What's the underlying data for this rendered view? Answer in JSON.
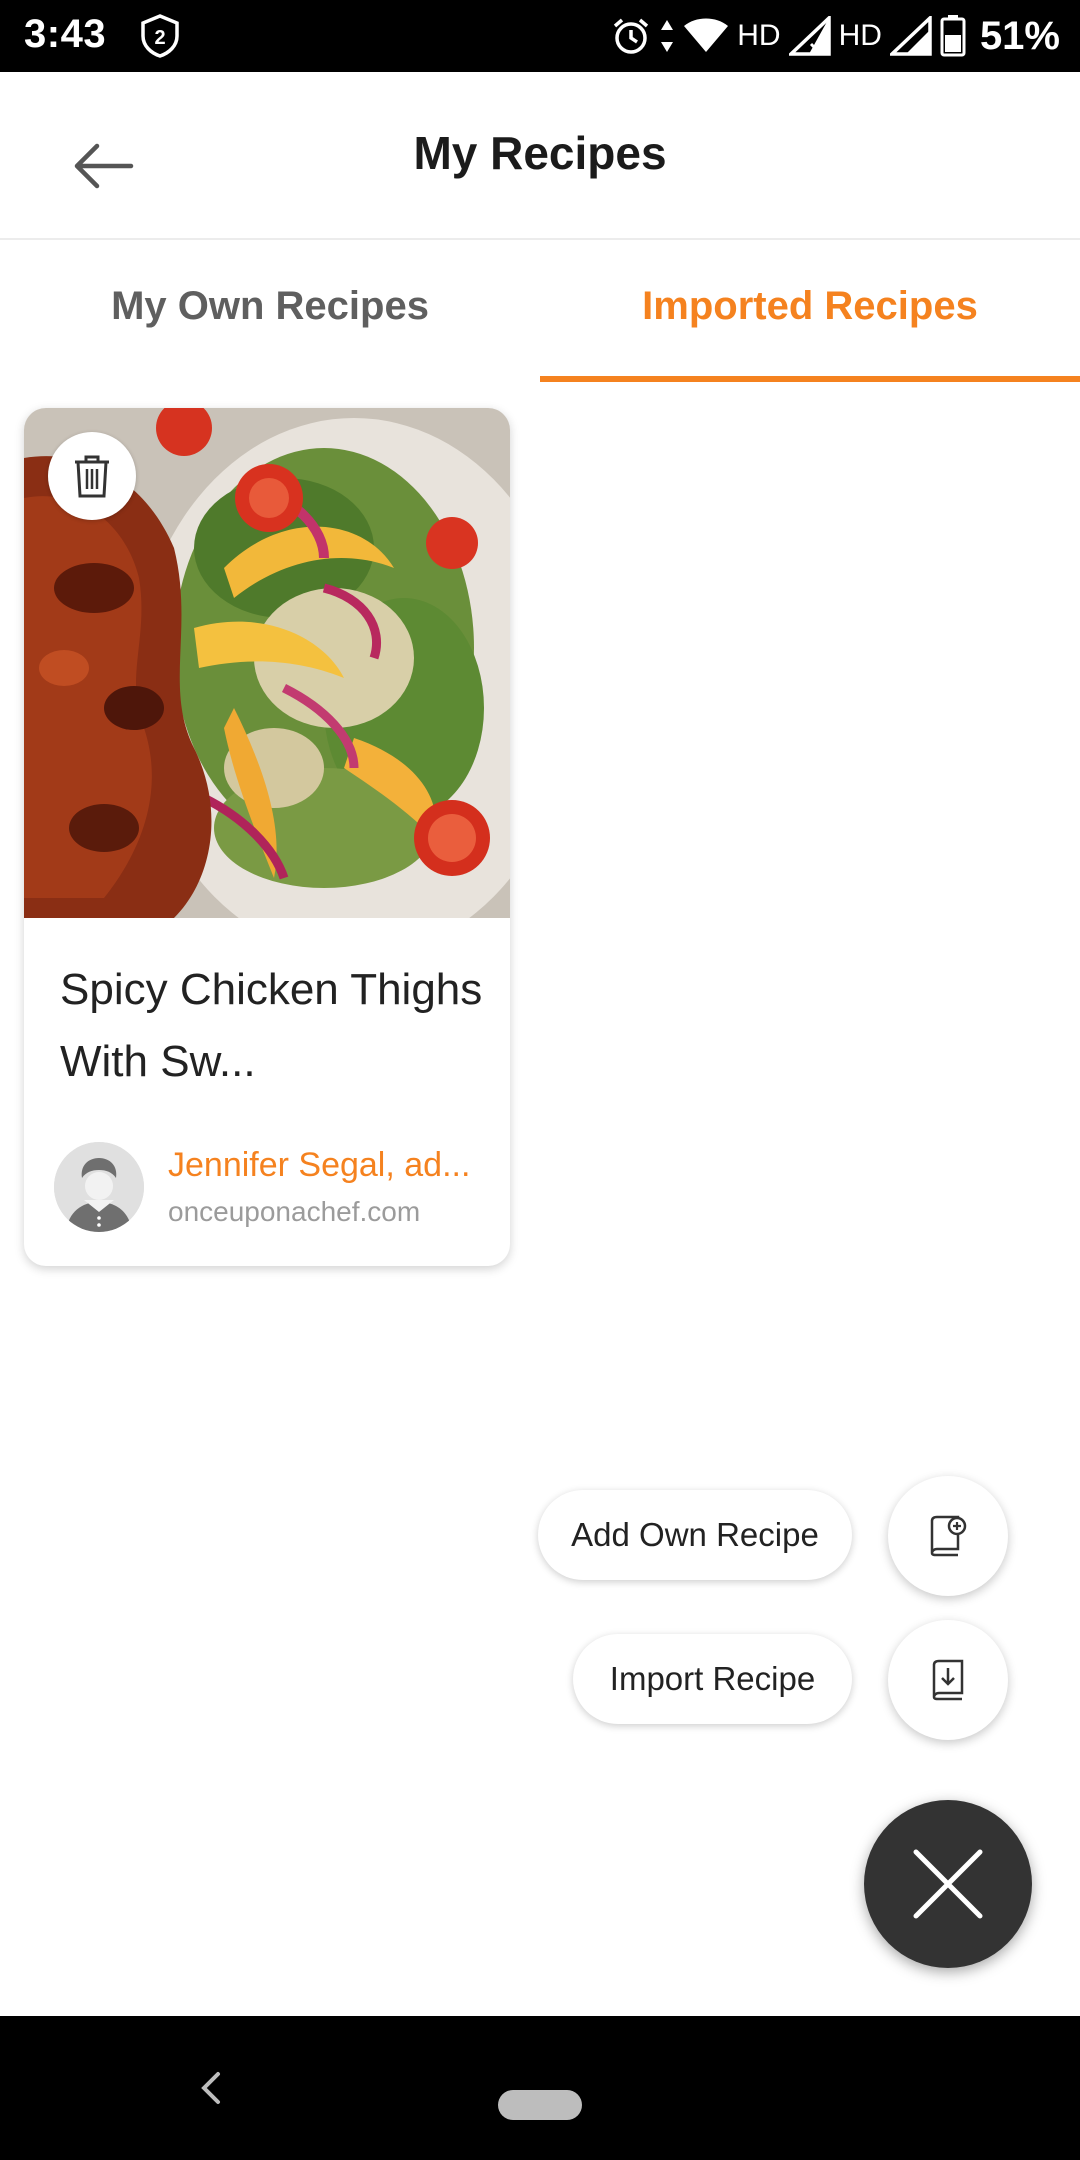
{
  "status_bar": {
    "time": "3:43",
    "notification_badge": "2",
    "network_1": "HD",
    "network_2": "HD",
    "battery": "51%",
    "icons": [
      "shield-badge-icon",
      "alarm-icon",
      "data-arrows-icon",
      "wifi-icon",
      "signal-icon",
      "signal-icon",
      "battery-icon"
    ]
  },
  "app_bar": {
    "title": "My Recipes",
    "back_icon": "arrow-left-icon"
  },
  "tabs": [
    {
      "label": "My Own Recipes",
      "selected": false
    },
    {
      "label": "Imported Recipes",
      "selected": true
    }
  ],
  "recipes": [
    {
      "title": "Spicy Chicken Thighs With Sw...",
      "author": "Jennifer Segal, ad...",
      "source": "onceuponachef.com",
      "delete_icon": "trash-icon",
      "image": "chicken-thighs-with-salad-photo"
    }
  ],
  "speed_dial": {
    "add_label": "Add Own Recipe",
    "add_icon": "book-plus-icon",
    "import_label": "Import Recipe",
    "import_icon": "book-download-icon",
    "close_icon": "close-icon"
  },
  "colors": {
    "accent": "#f5821f",
    "fab": "#333333",
    "text": "#222222",
    "muted": "#9b9b9b"
  },
  "nav_bar": {
    "icons": [
      "nav-back-icon",
      "home-pill-icon"
    ]
  }
}
